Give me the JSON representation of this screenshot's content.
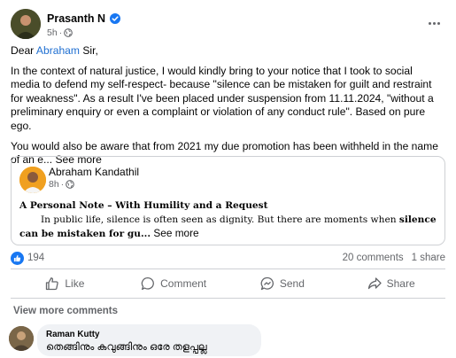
{
  "post": {
    "author": "Prasanth N",
    "time": "5h",
    "dot": "·",
    "paragraphs": {
      "p1_before": "Dear ",
      "p1_mention": "Abraham",
      "p1_after": " Sir,",
      "p2": "In the context of natural justice, I would kindly bring to your notice that I took to social media to defend my self-respect- because \"silence can be mistaken for guilt and restraint for weakness\". As a result I've been placed under suspension from 11.11.2024, \"without a preliminary enquiry or even a complaint or violation of any conduct rule\". Based on pure ego.",
      "p3": "You would also be aware that from 2021 my due promotion has been withheld in the name of an e...",
      "see_more": "See more"
    }
  },
  "shared": {
    "author": "Abraham Kandathil",
    "time": "8h",
    "dot": "·",
    "title": "A Personal Note – With Humility and a Request",
    "body_plain": "In public life, silence is often seen as dignity. But there are moments when ",
    "body_bold": "silence can be mistaken for gu...",
    "see_more": "See more"
  },
  "stats": {
    "likes": "194",
    "comments": "20 comments",
    "shares": "1 share"
  },
  "actions": {
    "like": "Like",
    "comment": "Comment",
    "send": "Send",
    "share": "Share"
  },
  "comments": {
    "view_more": "View more comments",
    "items": [
      {
        "author": "Raman Kutty",
        "text": "തെങ്ങിനും കവുങ്ങിനും ഒരേ തളപ്പല്ല"
      }
    ]
  },
  "colors": {
    "accent": "#1877f2",
    "mention": "#1f6fd1",
    "secondary_text": "#65676b",
    "bubble_bg": "#f0f2f5"
  },
  "icons": [
    "verified-icon",
    "globe-icon",
    "more-options-icon",
    "like-reaction-icon",
    "like-icon",
    "comment-icon",
    "send-icon",
    "share-icon"
  ]
}
